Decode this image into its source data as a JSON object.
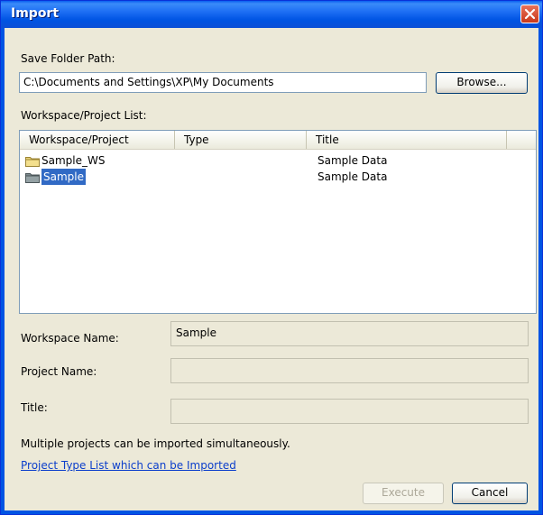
{
  "window": {
    "title": "Import"
  },
  "save_folder": {
    "label": "Save Folder Path:",
    "value": "C:\\Documents and Settings\\XP\\My Documents",
    "browse_label": "Browse..."
  },
  "list": {
    "label": "Workspace/Project List:",
    "columns": [
      "Workspace/Project",
      "Type",
      "Title"
    ],
    "rows": [
      {
        "name": "Sample_WS",
        "type": "",
        "title": "Sample Data",
        "icon": "folder-icon",
        "selected": false
      },
      {
        "name": "Sample",
        "type": "",
        "title": "Sample Data",
        "icon": "folder-icon",
        "selected": true
      }
    ]
  },
  "fields": {
    "workspace_name_label": "Workspace Name:",
    "workspace_name_value": "Sample",
    "project_name_label": "Project Name:",
    "project_name_value": "",
    "title_label": "Title:",
    "title_value": ""
  },
  "info_text": "Multiple projects can be imported simultaneously.",
  "link_text": "Project Type List which can be Imported",
  "buttons": {
    "execute": "Execute",
    "cancel": "Cancel"
  },
  "colors": {
    "titlebar": "#0054e3",
    "selection": "#316ac5",
    "link": "#0b3ecb",
    "dialog_bg": "#ece9d8"
  }
}
